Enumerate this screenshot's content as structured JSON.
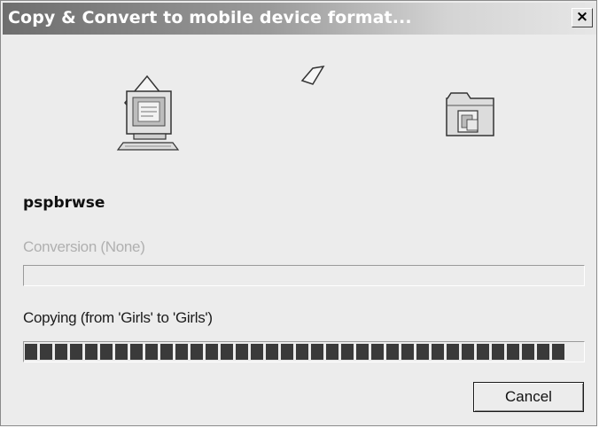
{
  "window": {
    "title": "Copy & Convert to mobile device format...",
    "close_symbol": "✕"
  },
  "animation": {
    "source_icon": "computer-icon",
    "flying_icon": "flying-document-icon",
    "destination_icon": "folder-icon"
  },
  "file": {
    "name": "pspbrwse"
  },
  "conversion": {
    "label": "Conversion (None)",
    "enabled": false,
    "progress": 0
  },
  "copying": {
    "label": "Copying (from 'Girls' to 'Girls')",
    "progress": 1.0
  },
  "buttons": {
    "cancel_label": "Cancel"
  },
  "colors": {
    "progress_fill": "#3a3a3a",
    "disabled_text": "#b0b0b0"
  }
}
